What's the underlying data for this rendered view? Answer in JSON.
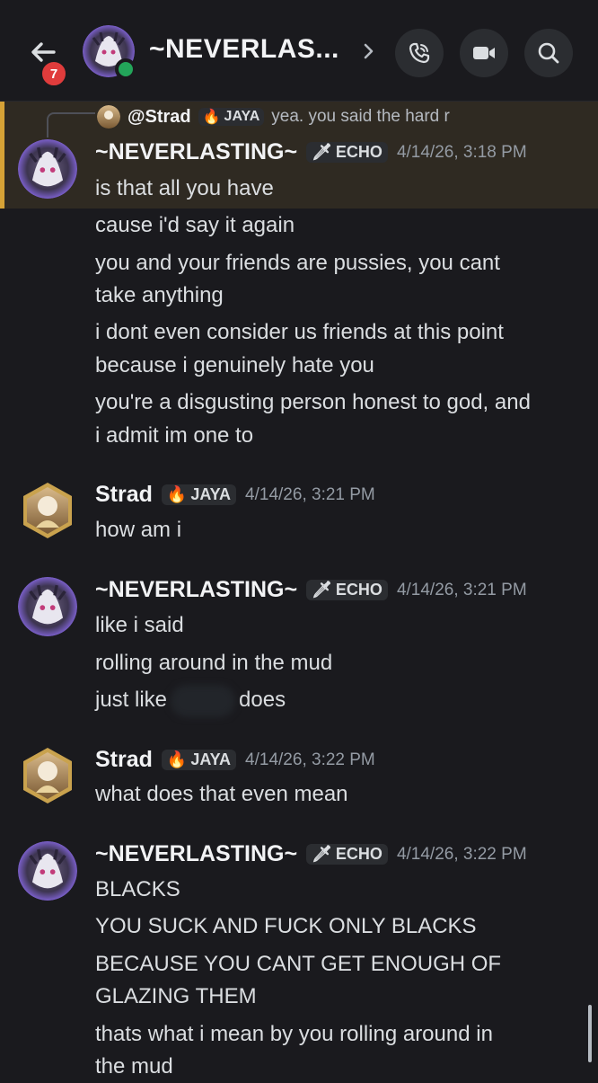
{
  "header": {
    "unread_badge": "7",
    "channel_title": "~NEVERLAS...",
    "icons": [
      "back-arrow-icon",
      "chevron-right-icon",
      "phone-call-icon",
      "video-camera-icon",
      "search-icon"
    ]
  },
  "reply": {
    "author": "@Strad",
    "tag": "JAYA",
    "text": "yea. you said the hard r"
  },
  "messages": [
    {
      "author": "~NEVERLASTING~",
      "tag": "ECHO",
      "timestamp": "4/14/26, 3:18 PM",
      "lines": [
        "is that all you have",
        "cause i'd say it again",
        "you and your friends are pussies, you cant",
        "take anything",
        "i dont even consider us friends at this point",
        "because i genuinely hate you",
        "you're a disgusting person honest to god, and",
        "i admit im one to"
      ]
    },
    {
      "author": "Strad",
      "tag": "JAYA",
      "timestamp": "4/14/26, 3:21 PM",
      "lines": [
        "how am i"
      ]
    },
    {
      "author": "~NEVERLASTING~",
      "tag": "ECHO",
      "timestamp": "4/14/26, 3:21 PM",
      "lines": [
        "like i said",
        "rolling around in the mud",
        "just like",
        "does"
      ]
    },
    {
      "author": "Strad",
      "tag": "JAYA",
      "timestamp": "4/14/26, 3:22 PM",
      "lines": [
        "what does that even mean"
      ]
    },
    {
      "author": "~NEVERLASTING~",
      "tag": "ECHO",
      "timestamp": "4/14/26, 3:22 PM",
      "lines": [
        "BLACKS",
        "YOU SUCK AND FUCK ONLY BLACKS",
        "BECAUSE YOU CANT GET ENOUGH OF",
        "GLAZING THEM",
        "thats what i mean by you rolling around in",
        "the mud"
      ]
    }
  ],
  "colors": {
    "background": "#1a1a1e",
    "highlight": "#2f2a22",
    "highlight_bar": "#d6a236",
    "online": "#23a55a",
    "badge": "#e03c3c"
  }
}
